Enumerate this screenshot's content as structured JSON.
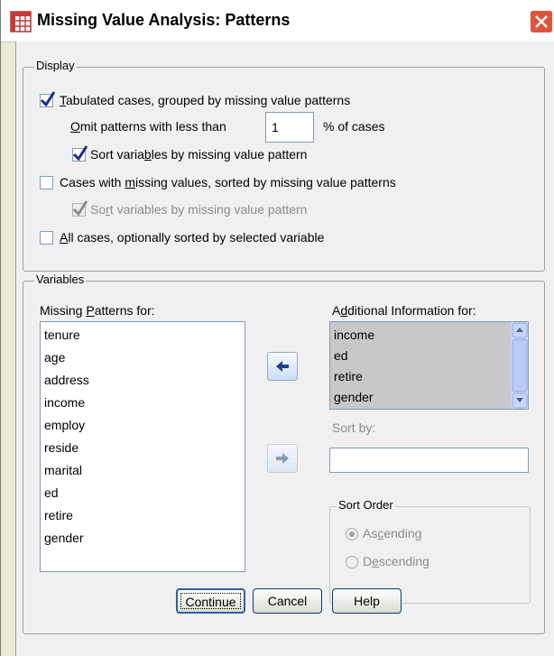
{
  "window": {
    "title": "Missing Value Analysis: Patterns"
  },
  "display": {
    "legend": "Display",
    "tabulated": {
      "label_pre": "",
      "label_u": "T",
      "label_post": "abulated cases, grouped by missing value patterns",
      "checked": true
    },
    "omit": {
      "label_pre": "",
      "label_u": "O",
      "label_post": "mit patterns with less than",
      "value": "1",
      "suffix": "% of cases"
    },
    "sort_tab": {
      "label_pre": "Sort varia",
      "label_u": "b",
      "label_post": "les by missing value pattern",
      "checked": true
    },
    "cases_missing": {
      "label_pre": "Cases with ",
      "label_u": "m",
      "label_post": "issing values, sorted by missing value patterns",
      "checked": false
    },
    "sort_cases": {
      "label_pre": "So",
      "label_u": "r",
      "label_post": "t variables by missing value pattern",
      "checked": true,
      "disabled": true
    },
    "all_cases": {
      "label_pre": "",
      "label_u": "A",
      "label_post": "ll cases, optionally sorted by selected variable",
      "checked": false
    }
  },
  "variables": {
    "legend": "Variables",
    "missing_patterns": {
      "label_pre": "Missing ",
      "label_u": "P",
      "label_post": "atterns for:",
      "items": [
        "tenure",
        "age",
        "address",
        "income",
        "employ",
        "reside",
        "marital",
        "ed",
        "retire",
        "gender"
      ]
    },
    "additional": {
      "label_pre": "A",
      "label_u": "d",
      "label_post": "ditional Information for:",
      "items": [
        "income",
        "ed",
        "retire",
        "gender"
      ]
    },
    "sort_by": {
      "label": "Sort by:",
      "value": ""
    },
    "sort_order": {
      "legend": "Sort Order",
      "ascending": {
        "label_pre": "As",
        "label_u": "c",
        "label_post": "ending",
        "selected": true
      },
      "descending": {
        "label_pre": "D",
        "label_u": "e",
        "label_post": "scending",
        "selected": false
      }
    }
  },
  "buttons": {
    "continue": "Continue",
    "cancel": "Cancel",
    "help": "Help"
  },
  "colors": {
    "accent": "#2f5ea8",
    "checkmark": "#1f2b8a",
    "close_red": "#e0533a",
    "dialog_bg": "#f0f0f0"
  }
}
